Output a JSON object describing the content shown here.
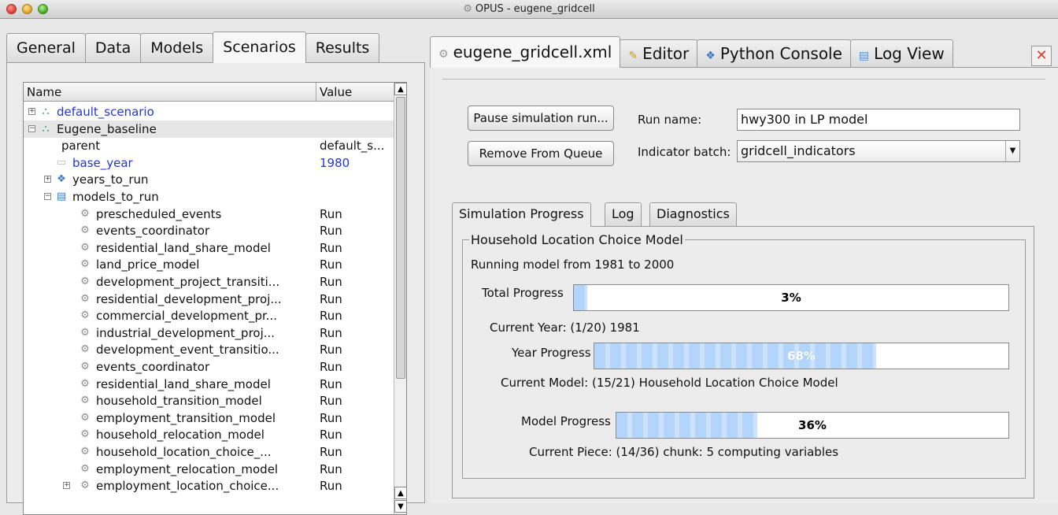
{
  "window": {
    "title": "OPUS - eugene_gridcell"
  },
  "left_tabs": [
    "General",
    "Data",
    "Models",
    "Scenarios",
    "Results"
  ],
  "left_active_tab": "Scenarios",
  "tree": {
    "col_name": "Name",
    "col_value": "Value",
    "rows": [
      {
        "label": "default_scenario",
        "value": "",
        "level": 0,
        "expander": "+",
        "icon": "scenario-icon",
        "blue": true
      },
      {
        "label": "Eugene_baseline",
        "value": "",
        "level": 0,
        "expander": "−",
        "icon": "scenario-icon",
        "blue": false,
        "selected": true
      },
      {
        "label": "parent",
        "value": "default_s...",
        "level": 1,
        "expander": "",
        "icon": "",
        "blue": false
      },
      {
        "label": "base_year",
        "value": "1980",
        "level": 1,
        "expander": "",
        "icon": "field-icon",
        "blue": true
      },
      {
        "label": "years_to_run",
        "value": "",
        "level": 1,
        "expander": "+",
        "icon": "python-icon",
        "blue": false
      },
      {
        "label": "models_to_run",
        "value": "",
        "level": 1,
        "expander": "−",
        "icon": "list-icon",
        "blue": false
      },
      {
        "label": "prescheduled_events",
        "value": "Run",
        "level": 2,
        "icon": "gear-icon"
      },
      {
        "label": "events_coordinator",
        "value": "Run",
        "level": 2,
        "icon": "gear-icon"
      },
      {
        "label": "residential_land_share_model",
        "value": "Run",
        "level": 2,
        "icon": "gear-icon"
      },
      {
        "label": "land_price_model",
        "value": "Run",
        "level": 2,
        "icon": "gear-icon"
      },
      {
        "label": "development_project_transiti...",
        "value": "Run",
        "level": 2,
        "icon": "gear-icon"
      },
      {
        "label": "residential_development_proj...",
        "value": "Run",
        "level": 2,
        "icon": "gear-icon"
      },
      {
        "label": "commercial_development_pr...",
        "value": "Run",
        "level": 2,
        "icon": "gear-icon"
      },
      {
        "label": "industrial_development_proj...",
        "value": "Run",
        "level": 2,
        "icon": "gear-icon"
      },
      {
        "label": "development_event_transitio...",
        "value": "Run",
        "level": 2,
        "icon": "gear-icon"
      },
      {
        "label": "events_coordinator",
        "value": "Run",
        "level": 2,
        "icon": "gear-icon"
      },
      {
        "label": "residential_land_share_model",
        "value": "Run",
        "level": 2,
        "icon": "gear-icon"
      },
      {
        "label": "household_transition_model",
        "value": "Run",
        "level": 2,
        "icon": "gear-icon"
      },
      {
        "label": "employment_transition_model",
        "value": "Run",
        "level": 2,
        "icon": "gear-icon"
      },
      {
        "label": "household_relocation_model",
        "value": "Run",
        "level": 2,
        "icon": "gear-icon"
      },
      {
        "label": "household_location_choice_...",
        "value": "Run",
        "level": 2,
        "icon": "gear-icon"
      },
      {
        "label": "employment_relocation_model",
        "value": "Run",
        "level": 2,
        "icon": "gear-icon"
      },
      {
        "label": "employment_location_choice...",
        "value": "Run",
        "level": 2,
        "icon": "gear-icon",
        "expander": "+"
      }
    ]
  },
  "right_tabs": [
    {
      "label": "eugene_gridcell.xml",
      "icon": "gear-icon"
    },
    {
      "label": "Editor",
      "icon": "editor-icon"
    },
    {
      "label": "Python Console",
      "icon": "python-icon"
    },
    {
      "label": "Log View",
      "icon": "log-icon"
    }
  ],
  "right_active_tab": "eugene_gridcell.xml",
  "controls": {
    "pause_button": "Pause simulation run...",
    "remove_button": "Remove From Queue",
    "run_name_label": "Run name:",
    "run_name_value": "hwy300 in LP model",
    "indicator_label": "Indicator batch:",
    "indicator_value": "gridcell_indicators"
  },
  "sub_tabs": [
    "Simulation Progress",
    "Log",
    "Diagnostics"
  ],
  "sub_active_tab": "Simulation Progress",
  "progress": {
    "group_title": "Household Location Choice Model",
    "running_text": "Running model from 1981 to 2000",
    "total_label": "Total Progress",
    "total_value": 3,
    "total_text": "3%",
    "current_year": "Current Year: (1/20) 1981",
    "year_label": "Year Progress",
    "year_value": 68,
    "year_text": "68%",
    "current_model": "Current Model: (15/21) Household Location Choice Model",
    "model_label": "Model Progress",
    "model_value": 36,
    "model_text": "36%",
    "current_piece": "Current Piece: (14/36) chunk: 5 computing variables"
  },
  "colors": {
    "link_blue": "#2536d6",
    "progress_fill": "#b3d4fb",
    "close_red": "#e03b2c"
  }
}
